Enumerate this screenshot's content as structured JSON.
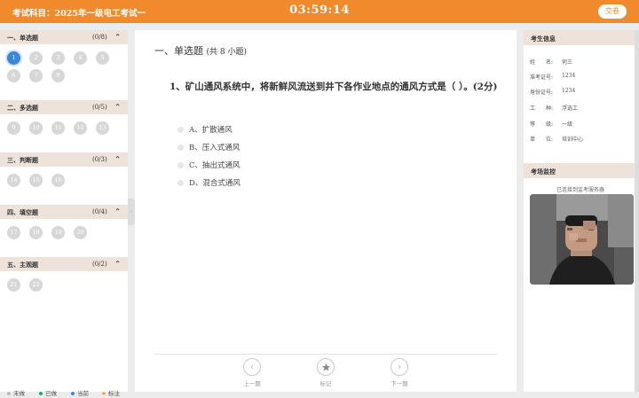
{
  "header": {
    "subject": "考试科目：2025年一级电工考试一",
    "timer": "03:59:14",
    "submit_label": "交卷"
  },
  "sidebar": {
    "sections": [
      {
        "title": "一、单选题",
        "count": "(0/8)",
        "numbers": [
          "1",
          "2",
          "3",
          "4",
          "5",
          "6",
          "7",
          "8"
        ],
        "current": "1"
      },
      {
        "title": "二、多选题",
        "count": "(0/5)",
        "numbers": [
          "9",
          "10",
          "11",
          "12",
          "13"
        ]
      },
      {
        "title": "三、判断题",
        "count": "(0/3)",
        "numbers": [
          "14",
          "15",
          "16"
        ]
      },
      {
        "title": "四、填空题",
        "count": "(0/4)",
        "numbers": [
          "17",
          "18",
          "19",
          "20"
        ]
      },
      {
        "title": "五、主观题",
        "count": "(0/2)",
        "numbers": [
          "21",
          "22"
        ]
      }
    ],
    "legend": [
      {
        "label": "未做",
        "color": "#bdbdbd"
      },
      {
        "label": "已做",
        "color": "#2aa37a"
      },
      {
        "label": "当前",
        "color": "#3a86d8"
      },
      {
        "label": "标注",
        "color": "#f08a2c"
      }
    ]
  },
  "question": {
    "section_title": "一、单选题",
    "section_sub": "(共 8 小题)",
    "text": "1、矿山通风系统中，将新鲜风流送到井下各作业地点的通风方式是（ ）。(2分)",
    "options": [
      "A、扩散通风",
      "B、压入式通风",
      "C、抽出式通风",
      "D、混合式通风"
    ]
  },
  "footer_nav": {
    "prev": "上一题",
    "mark": "标记",
    "next": "下一题"
  },
  "examinee": {
    "title": "考生信息",
    "fields": [
      {
        "label": "姓　　名:",
        "value": "何三"
      },
      {
        "label": "准考证号:",
        "value": "1234"
      },
      {
        "label": "身份证号:",
        "value": "1234"
      },
      {
        "label": "工　　种:",
        "value": "浮选工"
      },
      {
        "label": "等　　级:",
        "value": "一级"
      },
      {
        "label": "单　　位:",
        "value": "培训中心"
      }
    ]
  },
  "monitor": {
    "title": "考场监控",
    "status": "已连接到监考服务器"
  }
}
